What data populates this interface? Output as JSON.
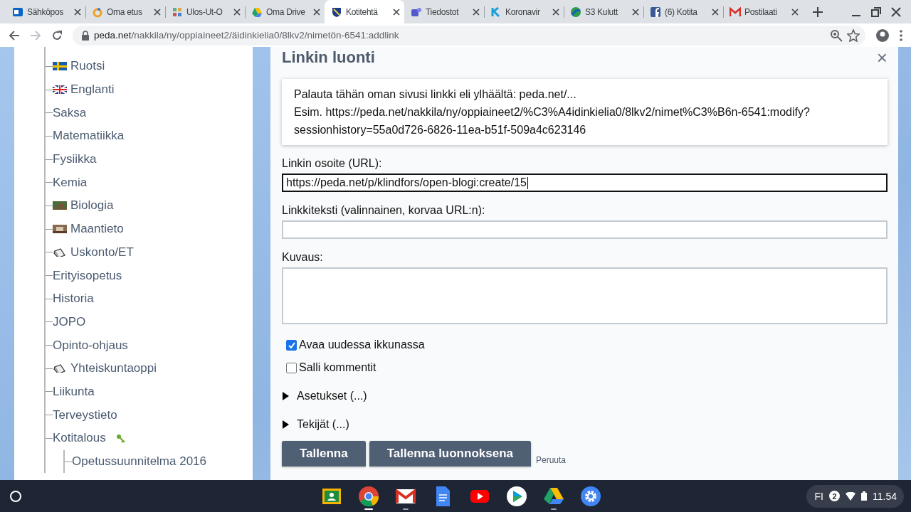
{
  "browser": {
    "tabs": [
      {
        "title": "Sähköpos",
        "kind": "mail-o",
        "selected": false
      },
      {
        "title": "Oma etus",
        "kind": "ring",
        "selected": false
      },
      {
        "title": "Ulos-Ut-O",
        "kind": "grid",
        "selected": false
      },
      {
        "title": "Oma Drive",
        "kind": "drive",
        "selected": false
      },
      {
        "title": "Kotitehtä",
        "kind": "shield",
        "selected": true
      },
      {
        "title": "Tiedostot",
        "kind": "people",
        "selected": false
      },
      {
        "title": "Koronavir",
        "kind": "k",
        "selected": false
      },
      {
        "title": "S3 Kulutt",
        "kind": "globe",
        "selected": false
      },
      {
        "title": "(6) Kotita",
        "kind": "f",
        "selected": false
      },
      {
        "title": "Postilaati",
        "kind": "m",
        "selected": false
      }
    ],
    "url_host": "peda.net",
    "url_path": "/nakkila/ny/oppiaineet2/äidinkielia0/8lkv2/nimetön-6541:addlink"
  },
  "sidebar": {
    "items": [
      {
        "label": "Ruotsi",
        "kind": "flag-se"
      },
      {
        "label": "Englanti",
        "kind": "flag-gb"
      },
      {
        "label": "Saksa"
      },
      {
        "label": "Matematiikka"
      },
      {
        "label": "Fysiikka"
      },
      {
        "label": "Kemia"
      },
      {
        "label": "Biologia",
        "kind": "photo-green"
      },
      {
        "label": "Maantieto",
        "kind": "photo-brown"
      },
      {
        "label": "Uskonto/ET",
        "kind": "book"
      },
      {
        "label": "Erityisopetus"
      },
      {
        "label": "Historia"
      },
      {
        "label": "JOPO"
      },
      {
        "label": "Opinto-ohjaus"
      },
      {
        "label": "Yhteiskuntaoppi",
        "kind": "book"
      },
      {
        "label": "Liikunta"
      },
      {
        "label": "Terveystieto"
      },
      {
        "label": "Kotitalous",
        "kind": "key",
        "children": [
          {
            "label": "Opetussuunnitelma 2016"
          }
        ]
      }
    ]
  },
  "dialog": {
    "title": "Linkin luonti",
    "close": "×",
    "info": [
      "Palauta tähän oman sivusi linkki eli ylhäältä: peda.net/...",
      "Esim. https://peda.net/nakkila/ny/oppiaineet2/%C3%A4idinkielia0/8lkv2/nimet%C3%B6n-6541:modify?sessionhistory=55a0d726-6826-11ea-b51f-509a4c623146"
    ],
    "fields": [
      {
        "label": "Linkin osoite (URL):",
        "kind": "input",
        "value": "https://peda.net/p/klindfors/open-blogi:create/15",
        "focused": true
      },
      {
        "label": "Linkkiteksti (valinnainen, korvaa URL:n):",
        "kind": "input",
        "focused": false
      },
      {
        "label": "Kuvaus:",
        "kind": "textarea",
        "focused": false
      }
    ],
    "checkboxes": [
      {
        "label": "Avaa uudessa ikkunassa",
        "checked": true
      },
      {
        "label": "Salli kommentit",
        "checked": false
      }
    ],
    "sections": [
      {
        "label": "Asetukset (...)",
        "expanded": false
      },
      {
        "label": "Tekijät (...)",
        "expanded": false
      }
    ],
    "buttons": [
      {
        "label": "Tallenna",
        "kind": "primary"
      },
      {
        "label": "Tallenna luonnoksena",
        "kind": "primary"
      },
      {
        "label": "Peruuta",
        "kind": "link"
      }
    ]
  },
  "shelf": {
    "apps": [
      {
        "kind": "board",
        "running": false,
        "active": false
      },
      {
        "kind": "browser",
        "running": true,
        "active": true
      },
      {
        "kind": "mail",
        "running": true,
        "active": false
      },
      {
        "kind": "document",
        "running": false,
        "active": false
      },
      {
        "kind": "video",
        "running": false,
        "active": false
      },
      {
        "kind": "store",
        "running": false,
        "active": false
      },
      {
        "kind": "drive",
        "running": true,
        "active": false
      },
      {
        "kind": "settings",
        "running": false,
        "active": false
      }
    ],
    "ime": "FI",
    "notifications": "2",
    "time": "11.54"
  }
}
